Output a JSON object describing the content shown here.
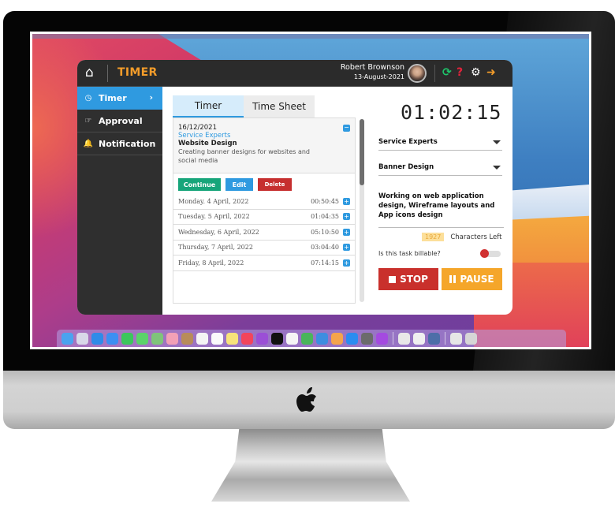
{
  "app": {
    "title": "TIMER",
    "user": {
      "name": "Robert Brownson",
      "date": "13-August-2021"
    },
    "header_icons": [
      "home-icon",
      "sync-icon",
      "help-icon",
      "gear-icon",
      "logout-icon"
    ]
  },
  "sidebar": {
    "items": [
      {
        "label": "Timer",
        "icon": "clock-icon",
        "active": true,
        "chevron": "›"
      },
      {
        "label": "Approval",
        "icon": "thumbs-up-icon",
        "active": false
      },
      {
        "label": "Notification",
        "icon": "bell-icon",
        "active": false
      }
    ]
  },
  "tabs": [
    {
      "label": "Timer",
      "active": true
    },
    {
      "label": "Time Sheet",
      "active": false
    }
  ],
  "task": {
    "date": "16/12/2021",
    "client": "Service Experts",
    "project": "Website Design",
    "description": "Creating banner designs for websites and social media",
    "actions": {
      "continue": "Continue",
      "edit": "Edit",
      "delete": "Delete"
    }
  },
  "entries": [
    {
      "day": "Monday. 4 April, 2022",
      "duration": "00:50:45"
    },
    {
      "day": "Tuesday. 5 April, 2022",
      "duration": "01:04:35"
    },
    {
      "day": "Wednesday, 6 April, 2022",
      "duration": "05:10:50"
    },
    {
      "day": "Thursday, 7 April, 2022",
      "duration": "03:04:40"
    },
    {
      "day": "Friday, 8 April, 2022",
      "duration": "07:14:15"
    }
  ],
  "timer_panel": {
    "clock": "01:02:15",
    "client_select": "Service Experts",
    "project_select": "Banner Design",
    "notes": "Working on web application design, Wireframe layouts and App icons design",
    "chars_left_count": "1927",
    "chars_left_label": "Characters Left",
    "billable_label": "Is this task billable?",
    "billable": true,
    "stop_label": "STOP",
    "pause_label": "PAUSE"
  },
  "colors": {
    "accent_orange": "#f39c2a",
    "accent_blue": "#2f9ae0",
    "stop_red": "#c9302c",
    "pause_orange": "#f5a62a",
    "continue_green": "#17a57a",
    "sidebar_dark": "#2f2f2f"
  },
  "dock": {
    "apps": [
      {
        "name": "finder",
        "color": "#4aa3ef"
      },
      {
        "name": "launchpad",
        "color": "#d8d8e8"
      },
      {
        "name": "safari",
        "color": "#2f8be8"
      },
      {
        "name": "mail",
        "color": "#3c8ff2"
      },
      {
        "name": "facetime",
        "color": "#3cc65c"
      },
      {
        "name": "messages",
        "color": "#5bd36a"
      },
      {
        "name": "maps",
        "color": "#7fc47a"
      },
      {
        "name": "photos",
        "color": "#f2a0b6"
      },
      {
        "name": "contacts",
        "color": "#b88c5a"
      },
      {
        "name": "calendar",
        "color": "#f4f4f4"
      },
      {
        "name": "reminders",
        "color": "#fafafa"
      },
      {
        "name": "notes",
        "color": "#f7e37a"
      },
      {
        "name": "music",
        "color": "#f2455c"
      },
      {
        "name": "podcasts",
        "color": "#9b4fd6"
      },
      {
        "name": "tv",
        "color": "#111111"
      },
      {
        "name": "news",
        "color": "#f5f5f5"
      },
      {
        "name": "numbers",
        "color": "#49b55a"
      },
      {
        "name": "keynote",
        "color": "#3e8de0"
      },
      {
        "name": "pages",
        "color": "#f4a44c"
      },
      {
        "name": "app-store",
        "color": "#2b8cf0"
      },
      {
        "name": "system-preferences",
        "color": "#6b6b6b"
      },
      {
        "name": "feedback",
        "color": "#a44ae0"
      },
      {
        "name": "chrome",
        "color": "#e8e8e8"
      },
      {
        "name": "slack",
        "color": "#f0f0f0"
      },
      {
        "name": "preview",
        "color": "#4d6ea8"
      },
      {
        "name": "documents",
        "color": "#e6e6e6"
      },
      {
        "name": "trash",
        "color": "#d6d6d6"
      }
    ]
  }
}
